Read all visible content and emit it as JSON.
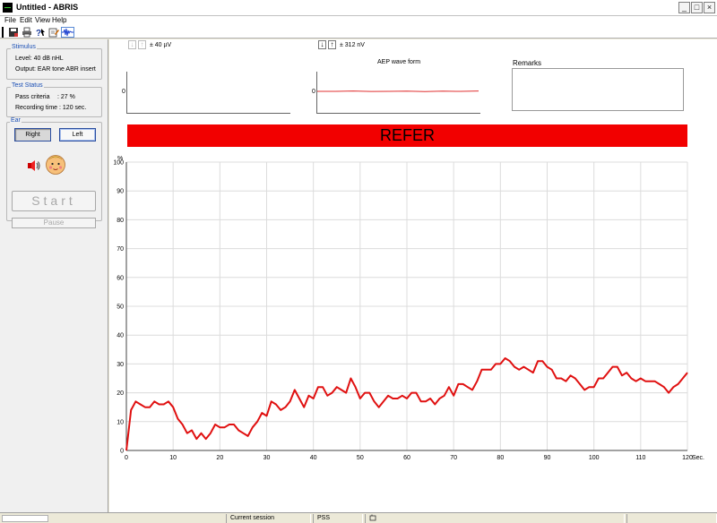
{
  "window": {
    "title": "Untitled - ABRIS"
  },
  "menu": {
    "file": "File",
    "edit": "Edit",
    "view": "View",
    "help": "Help"
  },
  "toolbar": {
    "icons": [
      "save-icon",
      "print-icon",
      "help-icon",
      "edit-icon",
      "waveform-icon"
    ]
  },
  "stimulus": {
    "title": "Stimulus",
    "level": "Level: 40 dB nHL",
    "output": "Output: EAR tone ABR insert"
  },
  "test_status": {
    "title": "Test Status",
    "pass_criteria": "Pass criteria",
    "pass_value": ": 27 %",
    "recording_time": "Recording time : 120 sec."
  },
  "ear": {
    "title": "Ear",
    "right": "Right",
    "left": "Left",
    "selected": "Right"
  },
  "controls": {
    "start": "Start",
    "pause": "Pause"
  },
  "eeg_panel": {
    "scale": "± 40 µV",
    "zero": "0"
  },
  "aep_panel": {
    "title": "AEP wave form",
    "scale": "± 312 nV",
    "zero": "0"
  },
  "remarks": {
    "label": "Remarks"
  },
  "result": {
    "text": "REFER",
    "color": "#f20000"
  },
  "status_bar": {
    "session": "Current session",
    "mode": "PSS"
  },
  "chart_data": {
    "type": "line",
    "ylabel": "%",
    "xlabel": "Sec.",
    "xlim": [
      0,
      120
    ],
    "ylim": [
      0,
      100
    ],
    "x_ticks": [
      "0",
      "10",
      "20",
      "30",
      "40",
      "50",
      "60",
      "70",
      "80",
      "90",
      "100",
      "110",
      "120"
    ],
    "y_ticks": [
      "0",
      "10",
      "20",
      "30",
      "40",
      "50",
      "60",
      "70",
      "80",
      "90",
      "100"
    ],
    "grid": true,
    "series": [
      {
        "color": "#e01010",
        "x": [
          0,
          1,
          2,
          3,
          4,
          5,
          6,
          7,
          8,
          9,
          10,
          11,
          12,
          13,
          14,
          15,
          16,
          17,
          18,
          19,
          20,
          21,
          22,
          23,
          24,
          25,
          26,
          27,
          28,
          29,
          30,
          31,
          32,
          33,
          34,
          35,
          36,
          37,
          38,
          39,
          40,
          41,
          42,
          43,
          44,
          45,
          46,
          47,
          48,
          49,
          50,
          51,
          52,
          53,
          54,
          55,
          56,
          57,
          58,
          59,
          60,
          61,
          62,
          63,
          64,
          65,
          66,
          67,
          68,
          69,
          70,
          71,
          72,
          73,
          74,
          75,
          76,
          77,
          78,
          79,
          80,
          81,
          82,
          83,
          84,
          85,
          86,
          87,
          88,
          89,
          90,
          91,
          92,
          93,
          94,
          95,
          96,
          97,
          98,
          99,
          100,
          101,
          102,
          103,
          104,
          105,
          106,
          107,
          108,
          109,
          110,
          111,
          112,
          113,
          114,
          115,
          116,
          117,
          118,
          119,
          120
        ],
        "y": [
          0,
          14,
          17,
          16,
          15,
          15,
          17,
          16,
          16,
          17,
          15,
          11,
          9,
          6,
          7,
          4,
          6,
          4,
          6,
          9,
          8,
          8,
          9,
          9,
          7,
          6,
          5,
          8,
          10,
          13,
          12,
          17,
          16,
          14,
          15,
          17,
          21,
          18,
          15,
          19,
          18,
          22,
          22,
          19,
          20,
          22,
          21,
          20,
          25,
          22,
          18,
          20,
          20,
          17,
          15,
          17,
          19,
          18,
          18,
          19,
          18,
          20,
          20,
          17,
          17,
          18,
          16,
          18,
          19,
          22,
          19,
          23,
          23,
          22,
          21,
          24,
          28,
          28,
          28,
          30,
          30,
          32,
          31,
          29,
          28,
          29,
          28,
          27,
          31,
          31,
          29,
          28,
          25,
          25,
          24,
          26,
          25,
          23,
          21,
          22,
          22,
          25,
          25,
          27,
          29,
          29,
          26,
          27,
          25,
          24,
          25,
          24,
          24,
          24,
          23,
          22,
          20,
          22,
          23,
          25,
          27
        ]
      }
    ]
  }
}
